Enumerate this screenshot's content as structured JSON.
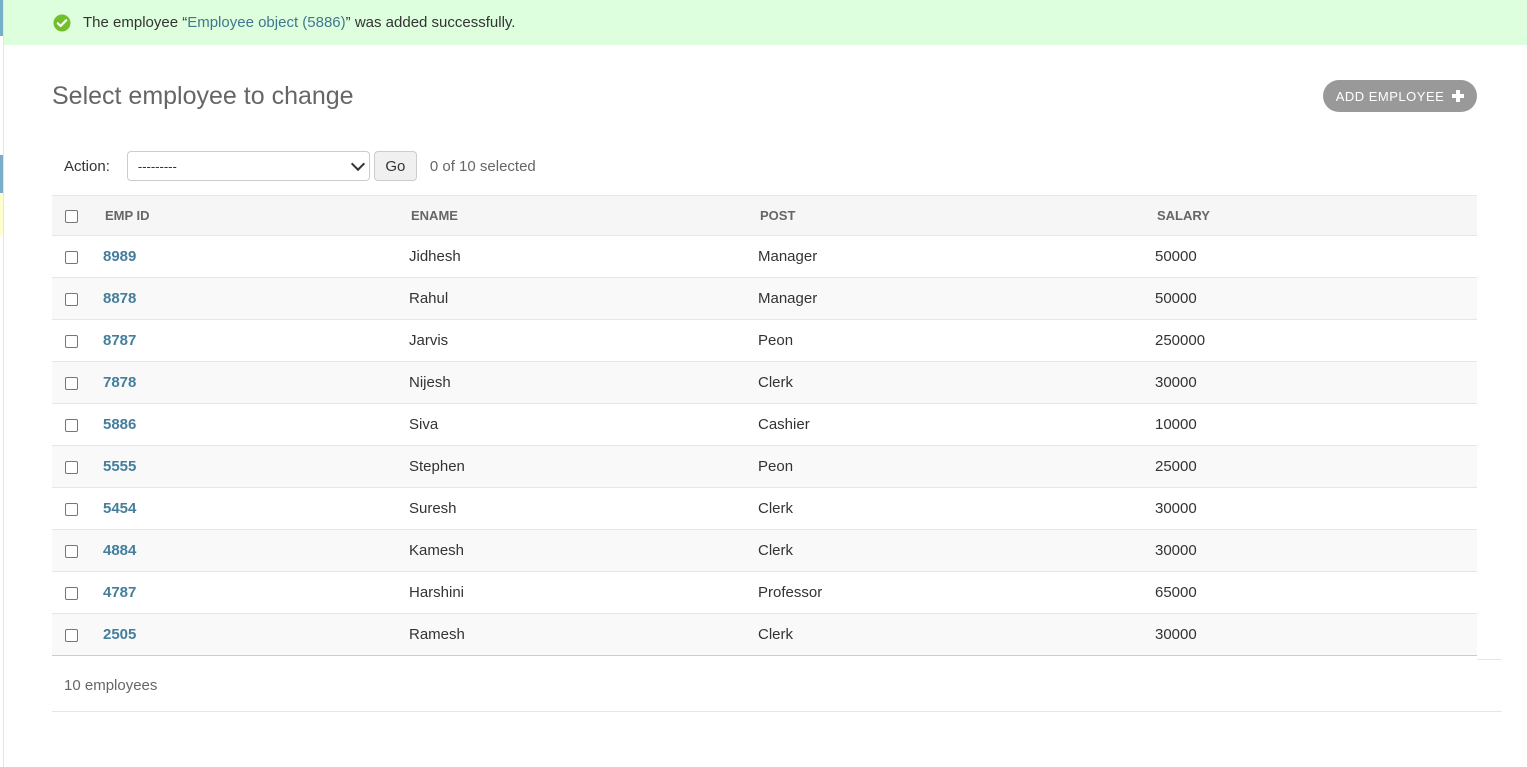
{
  "colors": {
    "success_bg": "#ddffdd",
    "link": "#447e9b",
    "button_gray": "#999999",
    "success_icon": "#70bf2b"
  },
  "message": {
    "icon": "check-circle-icon",
    "prefix": "The employee “",
    "link_text": "Employee object (5886)",
    "suffix": "” was added successfully."
  },
  "page_title": "Select employee to change",
  "add_button": {
    "label": "ADD EMPLOYEE",
    "icon": "plus-icon"
  },
  "actions": {
    "label": "Action:",
    "selected_value": "---------",
    "go_label": "Go",
    "selection_count": "0 of 10 selected"
  },
  "table": {
    "headers": {
      "emp_id": "EMP ID",
      "ename": "ENAME",
      "post": "POST",
      "salary": "SALARY"
    },
    "rows": [
      {
        "emp_id": "8989",
        "ename": "Jidhesh",
        "post": "Manager",
        "salary": "50000"
      },
      {
        "emp_id": "8878",
        "ename": "Rahul",
        "post": "Manager",
        "salary": "50000"
      },
      {
        "emp_id": "8787",
        "ename": "Jarvis",
        "post": "Peon",
        "salary": "250000"
      },
      {
        "emp_id": "7878",
        "ename": "Nijesh",
        "post": "Clerk",
        "salary": "30000"
      },
      {
        "emp_id": "5886",
        "ename": "Siva",
        "post": "Cashier",
        "salary": "10000"
      },
      {
        "emp_id": "5555",
        "ename": "Stephen",
        "post": "Peon",
        "salary": "25000"
      },
      {
        "emp_id": "5454",
        "ename": "Suresh",
        "post": "Clerk",
        "salary": "30000"
      },
      {
        "emp_id": "4884",
        "ename": "Kamesh",
        "post": "Clerk",
        "salary": "30000"
      },
      {
        "emp_id": "4787",
        "ename": "Harshini",
        "post": "Professor",
        "salary": "65000"
      },
      {
        "emp_id": "2505",
        "ename": "Ramesh",
        "post": "Clerk",
        "salary": "30000"
      }
    ]
  },
  "paginator": {
    "count_text": "10 employees"
  }
}
